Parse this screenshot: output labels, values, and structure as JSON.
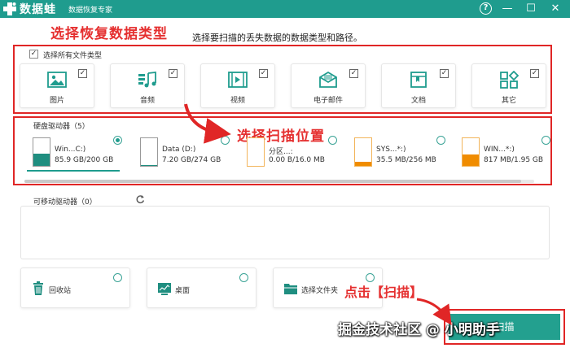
{
  "titlebar": {
    "app_name": "数据蛙",
    "app_subtitle": "数据恢复专家",
    "help_glyph": "?",
    "minimize_glyph": "—",
    "maximize_glyph": "☐",
    "close_glyph": "✕"
  },
  "instruction": "选择要扫描的丢失数据的数据类型和路径。",
  "annotations": {
    "select_types": "选择恢复数据类型",
    "select_location": "选择扫描位置",
    "click_scan": "点击【扫描】"
  },
  "file_types": {
    "select_all_label": "选择所有文件类型",
    "select_all_checked": true,
    "items": [
      {
        "label": "图片",
        "icon": "image-icon",
        "checked": true
      },
      {
        "label": "音频",
        "icon": "audio-icon",
        "checked": true
      },
      {
        "label": "视频",
        "icon": "video-icon",
        "checked": true
      },
      {
        "label": "电子邮件",
        "icon": "email-icon",
        "checked": true
      },
      {
        "label": "文档",
        "icon": "document-icon",
        "checked": true
      },
      {
        "label": "其它",
        "icon": "other-icon",
        "checked": true
      }
    ]
  },
  "hard_drives": {
    "title": "硬盘驱动器（5）",
    "items": [
      {
        "name": "Win...C:)",
        "size": "85.9 GB/200 GB",
        "used_fraction": 0.43,
        "fill_color": "#1f8e80",
        "selected": true
      },
      {
        "name": "Data (D:)",
        "size": "7.20 GB/274 GB",
        "used_fraction": 0.03,
        "fill_color": "#1f8e80",
        "selected": false
      },
      {
        "name": "分区...:",
        "size": "0.00  B/16.0 MB",
        "used_fraction": 0.0,
        "fill_color": "#f08c00",
        "selected": false
      },
      {
        "name": "SYS...*:)",
        "size": "35.5 MB/256 MB",
        "used_fraction": 0.14,
        "fill_color": "#f08c00",
        "selected": false
      },
      {
        "name": "WIN...*:)",
        "size": "817 MB/1.95 GB",
        "used_fraction": 0.42,
        "fill_color": "#f08c00",
        "selected": false
      }
    ]
  },
  "removable_drives": {
    "title": "可移动驱动器（0）"
  },
  "locations": [
    {
      "label": "回收站",
      "icon": "recycle-bin-icon"
    },
    {
      "label": "桌面",
      "icon": "desktop-icon"
    },
    {
      "label": "选择文件夹",
      "icon": "folder-icon"
    }
  ],
  "scan_button": {
    "label": "扫描"
  },
  "watermark": "掘金技术社区 @ 小明助手",
  "colors": {
    "brand": "#1f9c8e",
    "annotation_red": "#e53030",
    "removable_fill": "#f08c00"
  }
}
